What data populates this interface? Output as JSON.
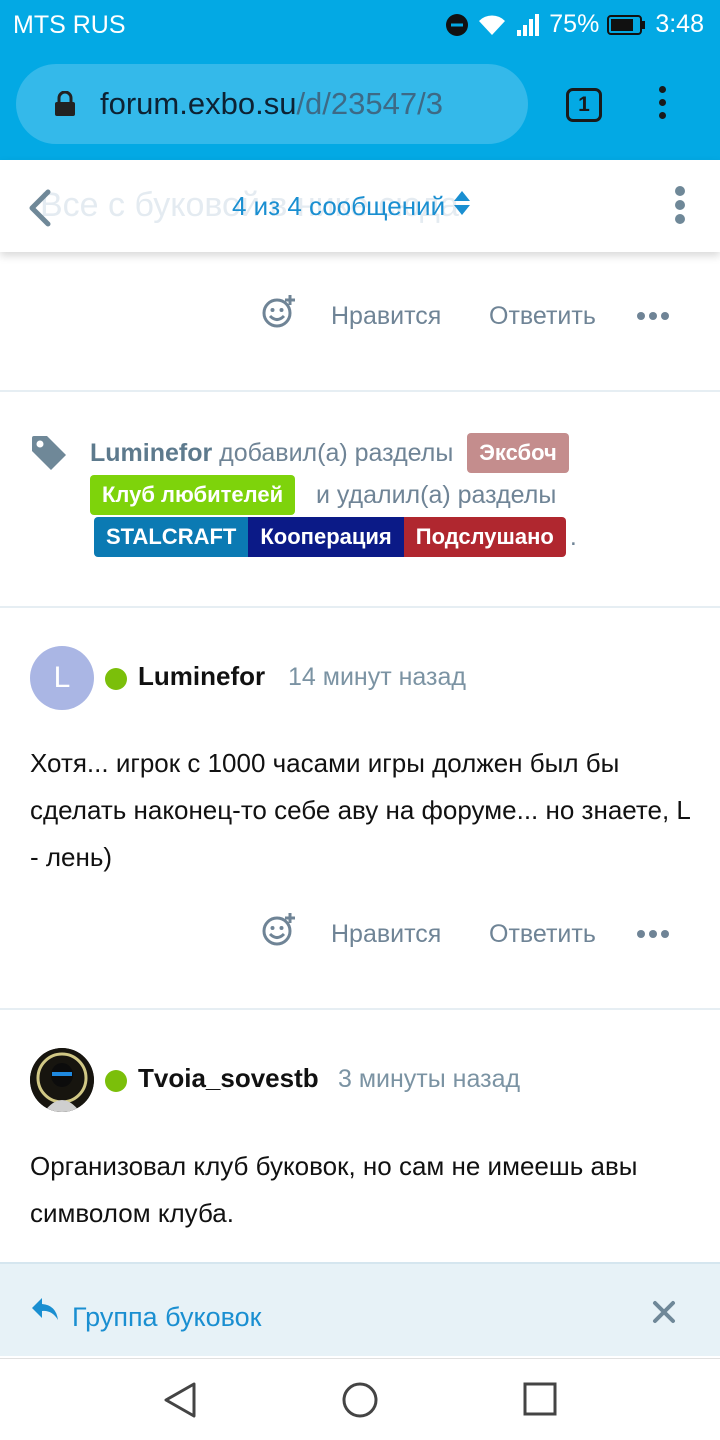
{
  "status_bar": {
    "carrier": "MTS RUS",
    "battery": "75%",
    "time": "3:48",
    "icons": [
      "do-not-disturb-icon",
      "wifi-icon",
      "signal-icon",
      "battery-icon"
    ]
  },
  "browser": {
    "url_domain": "forum.exbo.su",
    "url_path": "/d/23547/3",
    "tab_count": "1"
  },
  "discussion_header": {
    "ghost_title": "Все с буковой в нике сюда",
    "scrubber_label": "4 из 4 сообщений"
  },
  "post_actions": {
    "like_label": "Нравится",
    "reply_label": "Ответить"
  },
  "tag_event": {
    "user": "Luminefor",
    "added_text": "добавил(а) разделы",
    "added_tags": [
      {
        "label": "Эксбоч",
        "color": "#c48d8d"
      },
      {
        "label": "Клуб любителей",
        "color": "#7ed30b"
      }
    ],
    "removed_text": "и удалил(а) разделы",
    "removed_tags": [
      {
        "label": "STALCRAFT",
        "color": "#0b7ab3"
      },
      {
        "label": "Кооперация",
        "color": "#0b1a87"
      },
      {
        "label": "Подслушано",
        "color": "#b0272f"
      }
    ],
    "end_punct": "."
  },
  "posts": [
    {
      "avatar_letter": "L",
      "username": "Luminefor",
      "time": "14 минут назад",
      "body": "Хотя... игрок с 1000 часами игры должен был бы сделать наконец-то себе аву на форуме... но знаете, L - лень)"
    },
    {
      "username": "Tvoia_sovestb",
      "time": "3 минуты назад",
      "body": "Организовал клуб буковок, но сам не имеешь авы символом клуба."
    }
  ],
  "composer": {
    "title": "Группа буковок"
  },
  "colors": {
    "accent": "#03a9e4",
    "link": "#1a8fd1",
    "online": "#7bbf0a"
  }
}
